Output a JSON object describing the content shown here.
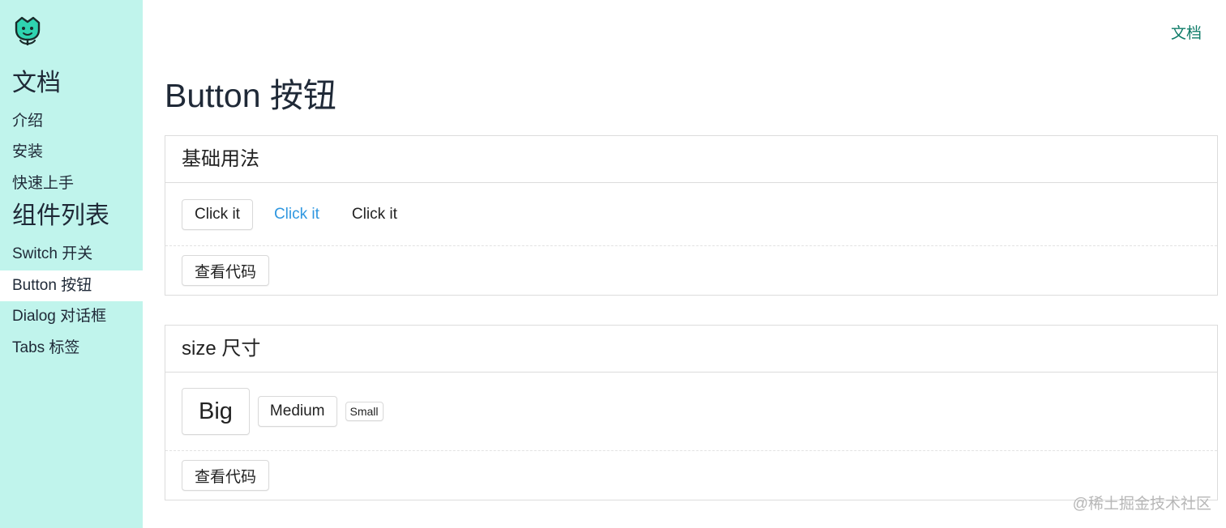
{
  "logo": {
    "icon": "tulip-face-logo-icon",
    "color": "#2fd3b0"
  },
  "header": {
    "link": "文档"
  },
  "sidebar": {
    "sections": [
      {
        "heading": "文档",
        "items": [
          "介绍",
          "安装",
          "快速上手"
        ]
      },
      {
        "heading": "组件列表",
        "items": [
          "Switch 开关",
          "Button 按钮",
          "Dialog 对话框",
          "Tabs 标签"
        ]
      }
    ],
    "active_item": "Button 按钮"
  },
  "page": {
    "title": "Button 按钮"
  },
  "demos": [
    {
      "title": "基础用法",
      "buttons": [
        "Click it",
        "Click it",
        "Click it"
      ],
      "code_button": "查看代码"
    },
    {
      "title": "size 尺寸",
      "buttons": [
        "Big",
        "Medium",
        "Small"
      ],
      "code_button": "查看代码"
    }
  ],
  "watermark": "@稀土掘金技术社区",
  "colors": {
    "sidebar_bg": "#c0f4ec",
    "link": "#0f7c69",
    "link_button": "#2f97e0"
  }
}
